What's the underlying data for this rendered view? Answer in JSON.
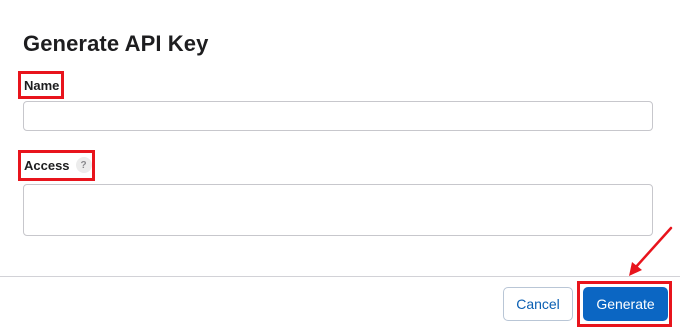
{
  "dialog": {
    "title": "Generate API Key"
  },
  "fields": {
    "name": {
      "label": "Name",
      "value": "",
      "placeholder": ""
    },
    "access": {
      "label": "Access",
      "help_glyph": "?",
      "value": "",
      "placeholder": ""
    }
  },
  "footer": {
    "cancel_label": "Cancel",
    "generate_label": "Generate"
  },
  "annotations": {
    "highlight_color": "#e8141c",
    "arrow_color": "#e8141c"
  },
  "colors": {
    "primary": "#0b66c3",
    "cancel_text": "#0a5fb3",
    "border": "#c7c7cc",
    "divider": "#d2d2d7"
  }
}
